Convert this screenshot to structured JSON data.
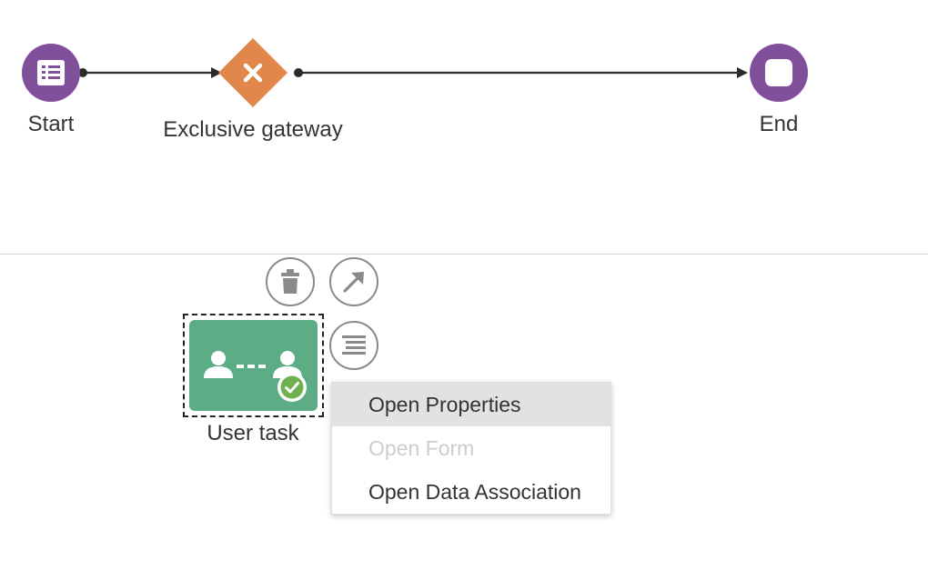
{
  "nodes": {
    "start": {
      "label": "Start",
      "color": "#80509b",
      "icon": "form-list-icon"
    },
    "gateway": {
      "label": "Exclusive gateway",
      "color": "#e2874b",
      "icon": "close-x-icon"
    },
    "end": {
      "label": "End",
      "color": "#80509b",
      "icon": "stop-square-icon"
    },
    "user_task": {
      "label": "User task",
      "color": "#5cac86",
      "icon": "user-handoff-icon",
      "badge": "check-icon",
      "badge_color": "#6fb04e"
    }
  },
  "edges": [
    {
      "from": "Start",
      "to": "Exclusive gateway"
    },
    {
      "from": "Exclusive gateway",
      "to": "End"
    }
  ],
  "toolbar": {
    "delete_icon": "trash-icon",
    "connect_icon": "arrow-diagonal-icon",
    "menu_icon": "menu-lines-icon"
  },
  "context_menu": {
    "items": [
      {
        "label": "Open Properties",
        "state": "hover"
      },
      {
        "label": "Open Form",
        "state": "disabled"
      },
      {
        "label": "Open Data Association",
        "state": "normal"
      }
    ]
  },
  "colors": {
    "edge": "#2b2b2b",
    "divider": "#d6d6d6",
    "button_border": "#8a8a8a",
    "menu_hover": "#e2e2e2",
    "menu_disabled": "#cdcdcd"
  }
}
